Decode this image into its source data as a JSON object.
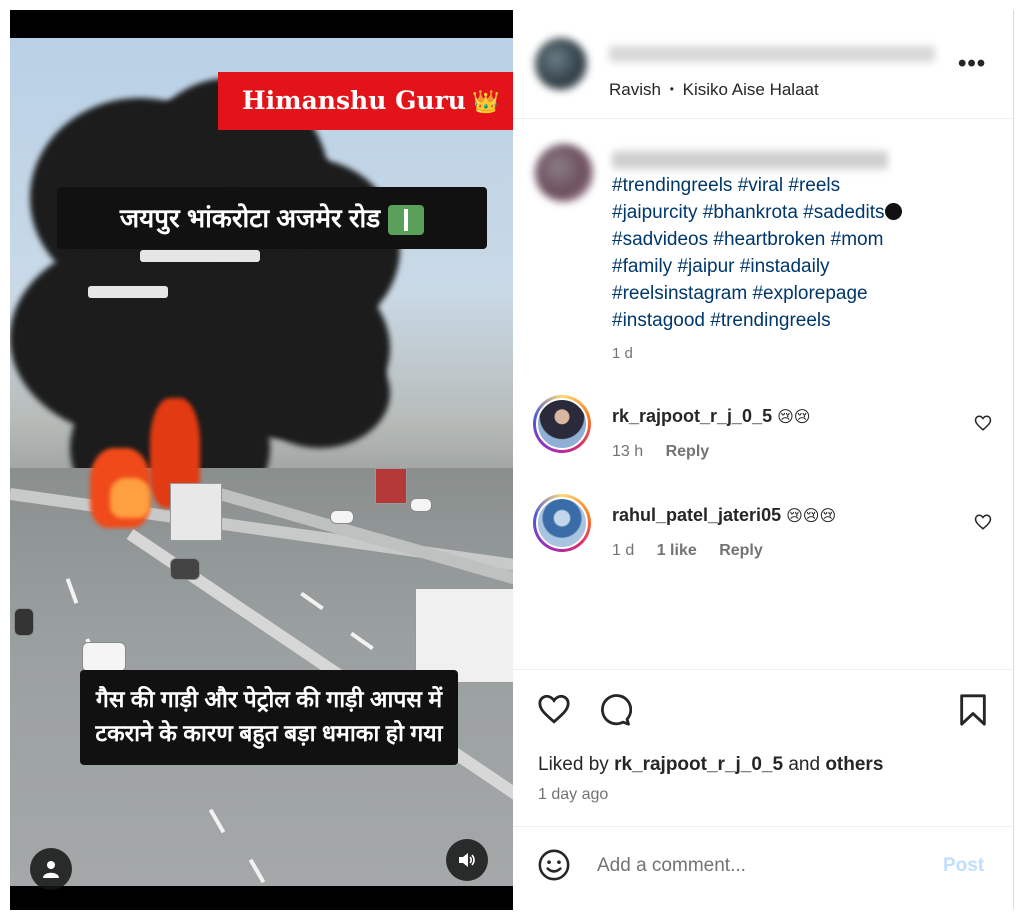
{
  "media": {
    "overlay_name": "Himanshu Guru",
    "overlay_crown": "👑",
    "caption_top": "जयपुर भांकरोटा अजमेर रोड",
    "caption_bottom_line1": "गैस की गाड़ी और पेट्रोल की गाड़ी आपस में",
    "caption_bottom_line2": "टकराने के कारण बहुत बड़ा धमाका हो गया",
    "user_button_icon": "person-icon",
    "sound_button_icon": "speaker-icon"
  },
  "header": {
    "audio_artist": "Ravish",
    "audio_separator": "•",
    "audio_title": "Kisiko Aise Halaat",
    "more_label": "•••"
  },
  "caption": {
    "hashtag_lines": [
      "#trendingreels #viral #reels",
      "#jaipurcity #bhankrota #sadedits",
      "#sadvideos #heartbroken #mom",
      "#family #jaipur #instadaily",
      "#reelsinstagram #explorepage",
      "#instagood #trendingreels"
    ],
    "time": "1 d"
  },
  "comments": [
    {
      "username": "rk_rajpoot_r_j_0_5",
      "emoji": "😢😢",
      "time": "13 h",
      "likes": "",
      "reply": "Reply"
    },
    {
      "username": "rahul_patel_jateri05",
      "emoji": "😢😢😢",
      "time": "1 d",
      "likes": "1 like",
      "reply": "Reply"
    }
  ],
  "footer": {
    "liked_by_prefix": "Liked by",
    "liked_by_user": "rk_rajpoot_r_j_0_5",
    "liked_by_and": "and",
    "liked_by_others": "others",
    "date": "1 day ago",
    "comment_placeholder": "Add a comment...",
    "post_label": "Post"
  },
  "colors": {
    "hashtag_link": "#00376b",
    "banner_red": "#e3131a",
    "post_disabled": "#c0dffd",
    "secondary_text": "#737373"
  }
}
